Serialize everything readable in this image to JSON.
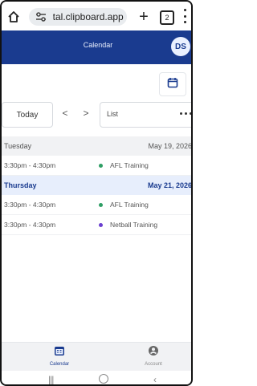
{
  "browser": {
    "url_text": "tal.clipboard.app",
    "tab_count": "2"
  },
  "app": {
    "title": "Calendar",
    "avatar_initials": "DS"
  },
  "toolbar": {
    "today_label": "Today",
    "prev_label": "<",
    "next_label": ">",
    "view_label": "List"
  },
  "list": {
    "days": [
      {
        "day": "Tuesday",
        "date": "May 19, 2026",
        "events": [
          {
            "time": "3:30pm - 4:30pm",
            "name": "AFL Training",
            "color": "#2e9e64"
          }
        ]
      },
      {
        "day": "Thursday",
        "date": "May 21, 2026",
        "events": [
          {
            "time": "3:30pm - 4:30pm",
            "name": "AFL Training",
            "color": "#2e9e64"
          },
          {
            "time": "3:30pm - 4:30pm",
            "name": "Netball Training",
            "color": "#6a3fd0"
          }
        ]
      }
    ]
  },
  "bottom_nav": {
    "calendar_label": "Calendar",
    "account_label": "Account"
  },
  "colors": {
    "brand": "#1a3b8f",
    "highlight_row": "#e7eefc"
  }
}
